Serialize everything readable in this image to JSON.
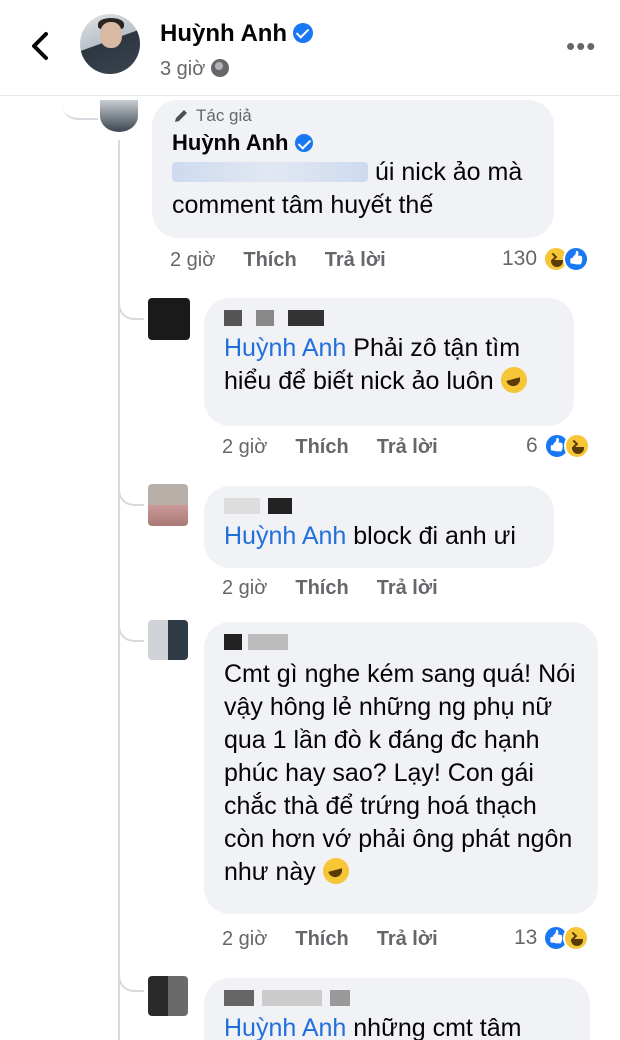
{
  "header": {
    "author_name": "Huỳnh Anh",
    "time": "3 giờ"
  },
  "labels": {
    "like": "Thích",
    "reply": "Trả lời",
    "author_tag": "Tác giả"
  },
  "comments": [
    {
      "name": "Huỳnh Anh",
      "text": "úi nick ảo mà comment tâm huyết thế",
      "time": "2 giờ",
      "reaction_count": "130",
      "reaction_icons": [
        "haha-icon",
        "like-icon"
      ]
    },
    {
      "mention": "Huỳnh Anh",
      "text": " Phải zô tận tìm hiểu để biết nick ảo luôn",
      "emoji": "rofl-icon",
      "time": "2 giờ",
      "reaction_count": "6",
      "reaction_icons": [
        "like-icon",
        "haha-icon"
      ]
    },
    {
      "mention": "Huỳnh Anh",
      "text": " block đi anh ưi",
      "time": "2 giờ"
    },
    {
      "text": "Cmt gì nghe kém sang quá! Nói vậy hông lẻ những ng phụ nữ qua 1 lần đò k đáng đc hạnh phúc hay sao? Lạy! Con gái  chắc thà để trứng hoá thạch còn hơn vớ phải ông phát ngôn như này",
      "emoji": "rofl-icon",
      "time": "2 giờ",
      "reaction_count": "13",
      "reaction_icons": [
        "like-icon",
        "haha-icon"
      ]
    },
    {
      "mention": "Huỳnh Anh",
      "text": " những cmt tâm"
    }
  ],
  "colors": {
    "mention": "#216fdb",
    "bubble": "#f0f2f5",
    "meta": "#65676b",
    "verified": "#1877f2"
  }
}
